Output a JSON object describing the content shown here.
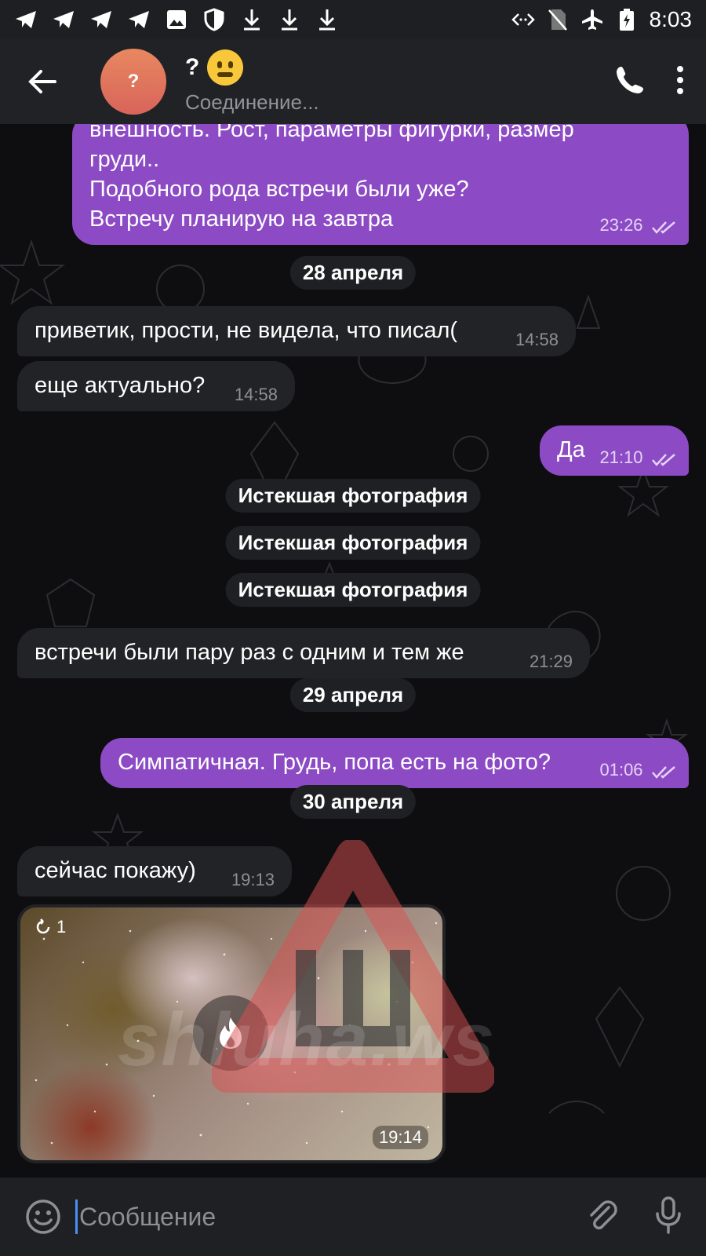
{
  "status_bar": {
    "time": "8:03"
  },
  "header": {
    "avatar_letter": "?",
    "title": "?",
    "subtitle": "Соединение..."
  },
  "messages": {
    "first_out": {
      "lines": [
        "внешность. Рост, параметры фигурки, размер",
        "груди..",
        "Подобного рода встречи были уже?",
        "Встречу планирую на завтра"
      ],
      "time": "23:26"
    },
    "date1": "28 апреля",
    "in1": {
      "text": "приветик, прости, не видела, что писал(",
      "time": "14:58"
    },
    "in2": {
      "text": "еще актуально?",
      "time": "14:58"
    },
    "out2": {
      "text": "Да",
      "time": "21:10"
    },
    "expired": [
      "Истекшая фотография",
      "Истекшая фотография",
      "Истекшая фотография"
    ],
    "in3": {
      "text": "встречи были пару раз с одним и тем же",
      "time": "21:29"
    },
    "date2": "29 апреля",
    "out3": {
      "text": "Симпатичная. Грудь, попа есть на фото?",
      "time": "01:06"
    },
    "date3": "30 апреля",
    "in4": {
      "text": "сейчас покажу)",
      "time": "19:13"
    },
    "photo": {
      "counter": "1",
      "time": "19:14"
    }
  },
  "watermark": "shluha.ws",
  "input": {
    "placeholder": "Сообщение"
  },
  "colors": {
    "outgoing": "#8c4bc4",
    "incoming": "#222326",
    "header": "#212226"
  }
}
